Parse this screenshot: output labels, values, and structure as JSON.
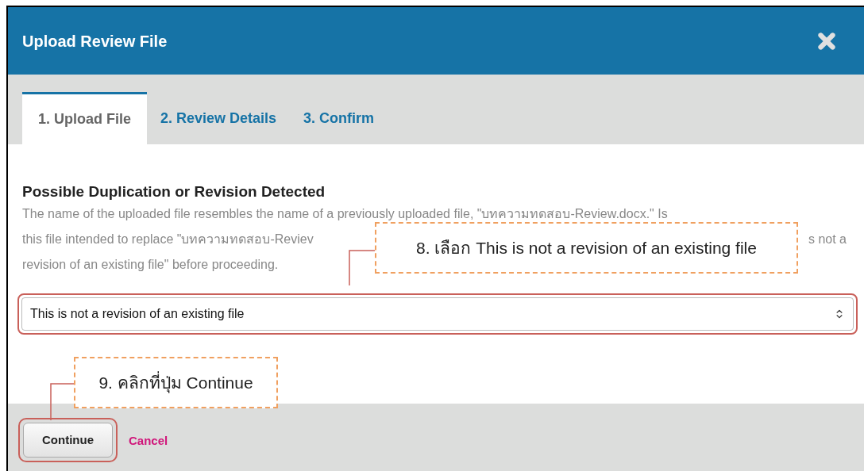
{
  "dialog": {
    "title": "Upload Review File"
  },
  "tabs": [
    {
      "label": "1. Upload File",
      "selected": true
    },
    {
      "label": "2. Review Details",
      "selected": false
    },
    {
      "label": "3. Confirm",
      "selected": false
    }
  ],
  "section": {
    "heading": "Possible Duplication or Revision Detected",
    "description_lines": [
      [
        "The name of the uploaded file resembles the name of a previously uploaded file, \"บทความทดสอบ-Review.docx.\" Is"
      ],
      [
        "this file intended to replace \"บทความทดสอบ-Reviev",
        "s not a"
      ],
      [
        "revision of an existing file\" before proceeding."
      ]
    ]
  },
  "select": {
    "value": "This is not a revision of an existing file"
  },
  "buttons": [
    {
      "label": "Continue",
      "kind": "button"
    },
    {
      "label": "Cancel",
      "kind": "link"
    }
  ],
  "callouts": [
    {
      "text": "8. เลือก This is not a revision of an existing file"
    },
    {
      "text": "9. คลิกที่ปุ่ม Continue"
    }
  ]
}
